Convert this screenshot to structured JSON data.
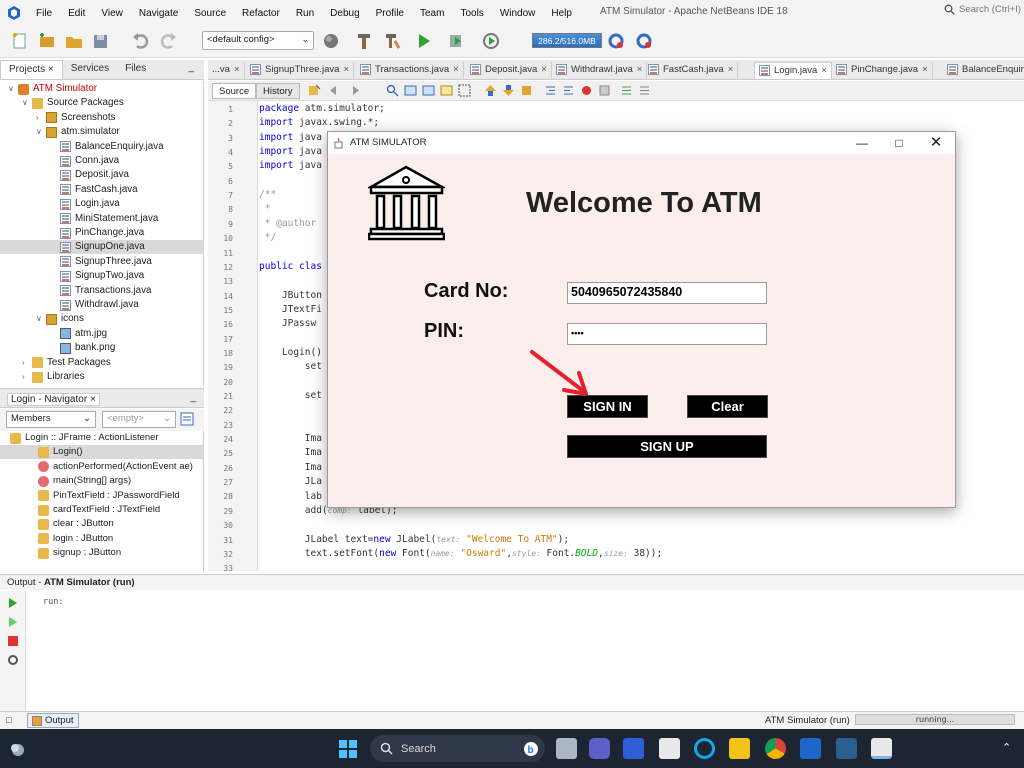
{
  "menubar": {
    "items": [
      "File",
      "Edit",
      "View",
      "Navigate",
      "Source",
      "Refactor",
      "Run",
      "Debug",
      "Profile",
      "Team",
      "Tools",
      "Window",
      "Help"
    ],
    "window_title": "ATM Simulator - Apache NetBeans IDE 18",
    "search_placeholder": "Search (Ctrl+I)"
  },
  "toolbar": {
    "config": "<default config>",
    "memory": "286.2/516.0MB"
  },
  "projects_panel": {
    "tabs": [
      "Projects",
      "Services",
      "Files"
    ],
    "minimize": "_",
    "tree": [
      {
        "label": "ATM Simulator",
        "depth": 0,
        "type": "project",
        "expanded": true
      },
      {
        "label": "Source Packages",
        "depth": 1,
        "type": "folder",
        "expanded": true
      },
      {
        "label": "Screenshots",
        "depth": 2,
        "type": "package",
        "expanded": false
      },
      {
        "label": "atm.simulator",
        "depth": 2,
        "type": "package",
        "expanded": true
      },
      {
        "label": "BalanceEnquiry.java",
        "depth": 3,
        "type": "java"
      },
      {
        "label": "Conn.java",
        "depth": 3,
        "type": "java"
      },
      {
        "label": "Deposit.java",
        "depth": 3,
        "type": "java"
      },
      {
        "label": "FastCash.java",
        "depth": 3,
        "type": "java"
      },
      {
        "label": "Login.java",
        "depth": 3,
        "type": "java"
      },
      {
        "label": "MiniStatement.java",
        "depth": 3,
        "type": "java"
      },
      {
        "label": "PinChange.java",
        "depth": 3,
        "type": "java"
      },
      {
        "label": "SignupOne.java",
        "depth": 3,
        "type": "java",
        "selected": true
      },
      {
        "label": "SignupThree.java",
        "depth": 3,
        "type": "java"
      },
      {
        "label": "SignupTwo.java",
        "depth": 3,
        "type": "java"
      },
      {
        "label": "Transactions.java",
        "depth": 3,
        "type": "java"
      },
      {
        "label": "Withdrawl.java",
        "depth": 3,
        "type": "java"
      },
      {
        "label": "icons",
        "depth": 2,
        "type": "package",
        "expanded": true
      },
      {
        "label": "atm.jpg",
        "depth": 3,
        "type": "image"
      },
      {
        "label": "bank.png",
        "depth": 3,
        "type": "image"
      },
      {
        "label": "Test Packages",
        "depth": 1,
        "type": "folder",
        "expanded": false
      },
      {
        "label": "Libraries",
        "depth": 1,
        "type": "folder",
        "expanded": false
      }
    ]
  },
  "navigator": {
    "title": "Login - Navigator",
    "filter": "Members",
    "empty": "<empty>",
    "minimize": "_",
    "items": [
      {
        "label": "Login :: JFrame : ActionListener",
        "depth": 0
      },
      {
        "label": "Login()",
        "depth": 1,
        "selected": true
      },
      {
        "label": "actionPerformed(ActionEvent ae)",
        "depth": 1
      },
      {
        "label": "main(String[] args)",
        "depth": 1
      },
      {
        "label": "PinTextField : JPasswordField",
        "depth": 1
      },
      {
        "label": "cardTextField : JTextField",
        "depth": 1
      },
      {
        "label": "clear : JButton",
        "depth": 1
      },
      {
        "label": "login : JButton",
        "depth": 1
      },
      {
        "label": "signup : JButton",
        "depth": 1
      }
    ]
  },
  "editor": {
    "tabs": [
      {
        "label": "...va"
      },
      {
        "label": "SignupThree.java"
      },
      {
        "label": "Transactions.java"
      },
      {
        "label": "Deposit.java"
      },
      {
        "label": "Withdrawl.java"
      },
      {
        "label": "FastCash.java"
      },
      {
        "label": "Login.java",
        "active": true
      },
      {
        "label": "PinChange.java"
      },
      {
        "label": "BalanceEnquiry.java"
      }
    ],
    "source_btn": "Source",
    "history_btn": "History",
    "line_numbers": [
      "1",
      "2",
      "3",
      "4",
      "5",
      "6",
      "7",
      "8",
      "9",
      "10",
      "11",
      "12",
      "13",
      "14",
      "15",
      "16",
      "17",
      "18",
      "19",
      "20",
      "21",
      "22",
      "23",
      "24",
      "25",
      "26",
      "27",
      "28",
      "29",
      "30",
      "31",
      "32",
      "33"
    ],
    "code": {
      "l1_kw": "package",
      "l1_rest": " atm.simulator;",
      "l2_kw": "import",
      "l2_rest": " javax.swing.*;",
      "l3_kw": "import",
      "l3_rest": " java",
      "l4_kw": "import",
      "l4_rest": " java",
      "l5_kw": "import",
      "l5_rest": " java",
      "l7": "/**",
      "l8": " *",
      "l9": " * @author",
      "l10": " */",
      "l12_kw": "public",
      "l12_rest": " clas",
      "l14": "    JButton",
      "l15": "    JTextFi",
      "l16": "    JPassw",
      "l18": "    Login()",
      "l19": "        set",
      "l21": "        set",
      "l24": "        Ima",
      "l25": "        Ima",
      "l26": "        Ima",
      "l27": "        JLa",
      "l28": "        lab",
      "l29_a": "        add(",
      "l29_hint": "comp:",
      "l29_b": " label);",
      "l31_a": "        JLabel text=",
      "l31_kw": "new",
      "l31_b": " JLabel(",
      "l31_hint": "text:",
      "l31_str": " \"Welcome To ATM\"",
      "l31_c": ");",
      "l32_a": "        text.setFont(",
      "l32_kw": "new",
      "l32_b": " Font(",
      "l32_h1": "name:",
      "l32_s": " \"Osward\"",
      "l32_c": ",",
      "l32_h2": "style:",
      "l32_d": " Font.",
      "l32_i": "BOLD",
      "l32_e": ",",
      "l32_h3": "size:",
      "l32_f": " 38));"
    }
  },
  "output": {
    "label_prefix": "Output - ",
    "label_bold": "ATM Simulator (run)",
    "text": "run:"
  },
  "statusbar": {
    "tab": "Output",
    "project": "ATM Simulator (run)",
    "progress": "running..."
  },
  "taskbar": {
    "search": "Search"
  },
  "dialog": {
    "title": "ATM SIMULATOR",
    "welcome": "Welcome To ATM",
    "card_label": "Card No:",
    "card_value": "5040965072435840",
    "pin_label": "PIN:",
    "pin_value": "••••",
    "signin": "SIGN IN",
    "clear": "Clear",
    "signup": "SIGN UP",
    "annotation_color": "#e8202e",
    "background": "#fbeeed"
  },
  "colors": {
    "accent": "#2c6fc0",
    "taskbar": "#1d2532"
  }
}
